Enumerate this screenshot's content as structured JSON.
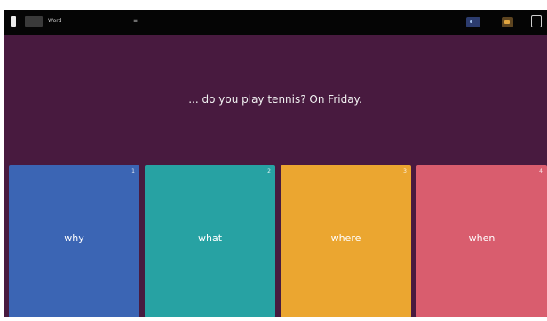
{
  "topbar": {
    "left_text": "Word",
    "menu_symbol": "≡"
  },
  "question": {
    "text": "... do you play tennis? On Friday."
  },
  "answers": [
    {
      "number": "1",
      "label": "why"
    },
    {
      "number": "2",
      "label": "what"
    },
    {
      "number": "3",
      "label": "where"
    },
    {
      "number": "4",
      "label": "when"
    }
  ],
  "colors": {
    "background": "#481a3f",
    "answer_1": "#3b65b4",
    "answer_2": "#27a2a3",
    "answer_3": "#eba630",
    "answer_4": "#d95d6e"
  }
}
